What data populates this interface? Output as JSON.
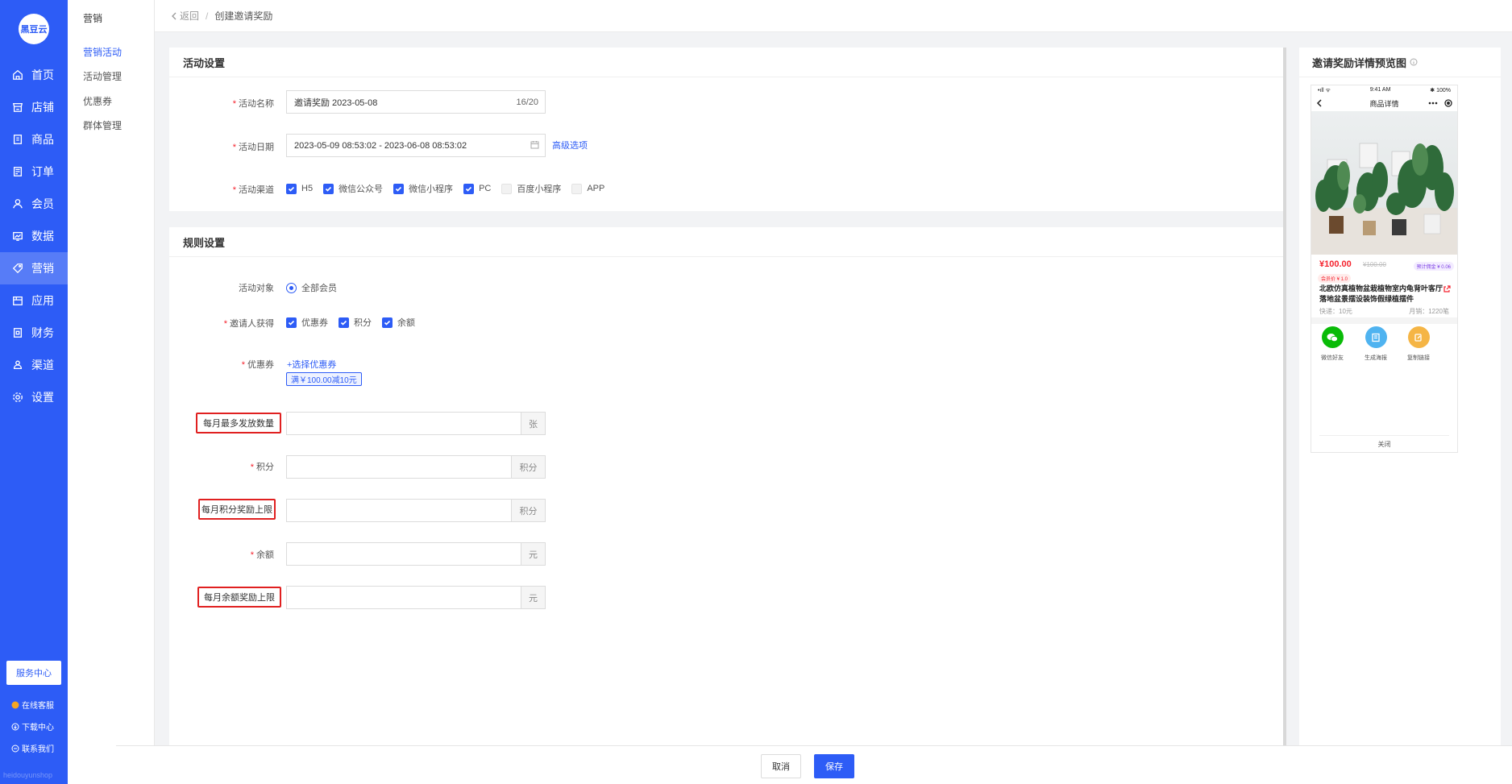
{
  "nav": {
    "logo": "黑豆云",
    "items": [
      {
        "label": "首页",
        "icon": "home-icon"
      },
      {
        "label": "店铺",
        "icon": "store-icon"
      },
      {
        "label": "商品",
        "icon": "goods-icon"
      },
      {
        "label": "订单",
        "icon": "order-icon"
      },
      {
        "label": "会员",
        "icon": "member-icon"
      },
      {
        "label": "数据",
        "icon": "data-icon"
      },
      {
        "label": "营销",
        "icon": "tag-icon"
      },
      {
        "label": "应用",
        "icon": "app-icon"
      },
      {
        "label": "财务",
        "icon": "finance-icon"
      },
      {
        "label": "渠道",
        "icon": "channel-icon"
      },
      {
        "label": "设置",
        "icon": "gear-icon"
      }
    ],
    "active": "营销",
    "service_center": "服务中心",
    "online_service": "在线客服",
    "download_center": "下载中心",
    "contact_us": "联系我们",
    "brand_footer": "heidouyunshop",
    "accent_color": "#2d5cf6"
  },
  "subnav": {
    "title": "营销",
    "items": [
      "营销活动",
      "活动管理",
      "优惠券",
      "群体管理"
    ],
    "active": "营销活动"
  },
  "breadcrumb": {
    "back": "返回",
    "separator": "/",
    "current": "创建邀请奖励"
  },
  "activity": {
    "title": "活动设置",
    "name_label": "活动名称",
    "name_value": "邀请奖励  2023-05-08",
    "name_count": "16/20",
    "date_label": "活动日期",
    "date_value": "2023-05-09 08:53:02 - 2023-06-08 08:53:02",
    "advanced": "高级选项",
    "channel_label": "活动渠道",
    "channels": [
      {
        "label": "H5",
        "checked": true
      },
      {
        "label": "微信公众号",
        "checked": true
      },
      {
        "label": "微信小程序",
        "checked": true
      },
      {
        "label": "PC",
        "checked": true
      },
      {
        "label": "百度小程序",
        "checked": false
      },
      {
        "label": "APP",
        "checked": false
      }
    ]
  },
  "rules": {
    "title": "规则设置",
    "target_label": "活动对象",
    "target_value": "全部会员",
    "inviter_label": "邀请人获得",
    "inviter_options": [
      {
        "label": "优惠券",
        "checked": true
      },
      {
        "label": "积分",
        "checked": true
      },
      {
        "label": "余额",
        "checked": true
      }
    ],
    "coupon_label": "优惠券",
    "coupon_select": "+选择优惠券",
    "coupon_tag": "满￥100.00减10元",
    "monthly_max_label": "每月最多发放数量",
    "monthly_max_suffix": "张",
    "points_label": "积分",
    "points_suffix": "积分",
    "points_cap_label": "每月积分奖励上限",
    "points_cap_suffix": "积分",
    "balance_label": "余额",
    "balance_suffix": "元",
    "balance_cap_label": "每月余额奖励上限",
    "balance_cap_suffix": "元"
  },
  "preview": {
    "title": "邀请奖励详情预览图",
    "status_signal": "•ıll ᯤ",
    "status_time": "9:41 AM",
    "status_battery": "✱ 100%",
    "page_title": "商品详情",
    "price": "¥100.00",
    "old_price": "¥100.00",
    "commission": "预计佣金 ¥ 0.06",
    "member_price": "会员价 ¥ 1.0",
    "product_name": "北欧仿真植物盆栽植物室内龟背叶客厅落地盆景摆设装饰假绿植摆件",
    "shipping": "快递：10元",
    "monthly_sales": "月销：1220笔",
    "share_wechat": "微信好友",
    "share_poster": "生成海报",
    "share_link": "复制链接",
    "close": "关闭"
  },
  "footer": {
    "cancel": "取消",
    "save": "保存"
  }
}
